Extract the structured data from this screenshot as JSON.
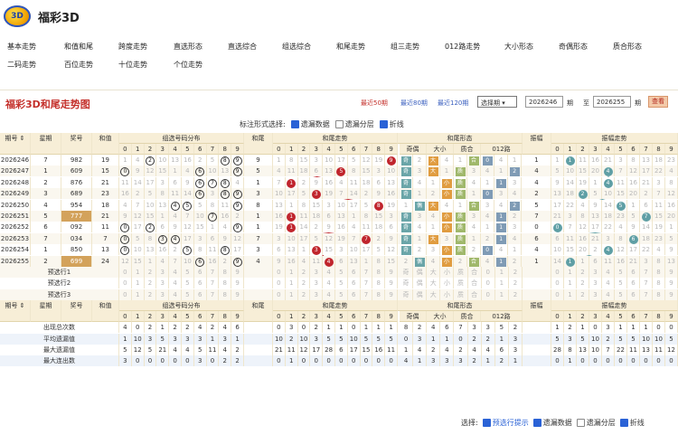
{
  "app": {
    "title": "福彩3D",
    "logo_text": "3D"
  },
  "nav": {
    "row1": [
      "基本走势",
      "和值和尾",
      "跨度走势",
      "直选形态",
      "直选综合",
      "组选综合",
      "和尾走势",
      "组三走势",
      "012路走势",
      "大小形态",
      "奇偶形态",
      "质合形态"
    ],
    "row2": [
      "二码走势",
      "百位走势",
      "十位走势",
      "个位走势"
    ]
  },
  "panel": {
    "title": "福彩3D和尾走势图",
    "recent_links": [
      "最近50期",
      "最近80期",
      "最近120期"
    ],
    "select_value": "选择期",
    "from_issue": "2026246",
    "from_suffix": "期",
    "to_label": "至",
    "to_issue": "2026255",
    "to_suffix": "期",
    "query_button": "查看",
    "opts_label": "标注形式选择:",
    "opts": [
      {
        "label": "遗漏数据",
        "checked": true
      },
      {
        "label": "遗漏分层",
        "checked": false
      },
      {
        "label": "折线",
        "checked": true
      }
    ]
  },
  "headers": {
    "issue": "期号",
    "weekday": "星期",
    "number": "奖号",
    "sum": "和值",
    "group_dist": "组选号码分布",
    "sum_tail": "和尾",
    "tail_trend": "和尾走势",
    "tail_shape": "和尾形态",
    "parity": "奇偶",
    "size": "大小",
    "prime": "质合",
    "road": "012路",
    "amplitude": "振幅",
    "amp_trend": "振幅走势",
    "digits": [
      "0",
      "1",
      "2",
      "3",
      "4",
      "5",
      "6",
      "7",
      "8",
      "9"
    ],
    "shape_sub": [
      "奇",
      "偶",
      "大",
      "小",
      "质",
      "合",
      "0",
      "1",
      "2"
    ]
  },
  "rows": [
    {
      "issue": "2026246",
      "week": "7",
      "num": "982",
      "sum": "19",
      "tail": "9",
      "amp": "1"
    },
    {
      "issue": "2026247",
      "week": "1",
      "num": "609",
      "sum": "15",
      "tail": "5",
      "amp": "4"
    },
    {
      "issue": "2026248",
      "week": "2",
      "num": "876",
      "sum": "21",
      "tail": "1",
      "amp": "4"
    },
    {
      "issue": "2026249",
      "week": "3",
      "num": "689",
      "sum": "23",
      "tail": "3",
      "amp": "2"
    },
    {
      "issue": "2026250",
      "week": "4",
      "num": "954",
      "sum": "18",
      "tail": "8",
      "amp": "5"
    },
    {
      "issue": "2026251",
      "week": "5",
      "num": "777",
      "sum": "21",
      "tail": "1",
      "amp": "7"
    },
    {
      "issue": "2026252",
      "week": "6",
      "num": "092",
      "sum": "11",
      "tail": "1",
      "amp": "0"
    },
    {
      "issue": "2026253",
      "week": "7",
      "num": "034",
      "sum": "7",
      "tail": "7",
      "amp": "6"
    },
    {
      "issue": "2026254",
      "week": "1",
      "num": "850",
      "sum": "13",
      "tail": "3",
      "amp": "4"
    },
    {
      "issue": "2026255",
      "week": "2",
      "num": "699",
      "sum": "24",
      "tail": "4",
      "amp": "1"
    }
  ],
  "prerows": [
    "预选行1",
    "预选行2",
    "预选行3"
  ],
  "stats": [
    {
      "label": "出现总次数",
      "group": [
        "4",
        "0",
        "2",
        "1",
        "2",
        "2",
        "4",
        "2",
        "4",
        "6"
      ],
      "tail": [
        "0",
        "3",
        "0",
        "2",
        "1",
        "1",
        "0",
        "1",
        "1",
        "1"
      ],
      "shape": [
        "8",
        "2",
        "4",
        "6",
        "7",
        "3",
        "3",
        "5",
        "2"
      ],
      "amp": [
        "1",
        "2",
        "1",
        "0",
        "3",
        "1",
        "1",
        "1",
        "0",
        "0"
      ]
    },
    {
      "label": "平均遗漏值",
      "group": [
        "1",
        "10",
        "3",
        "5",
        "3",
        "3",
        "3",
        "1",
        "3",
        "1"
      ],
      "tail": [
        "10",
        "2",
        "10",
        "3",
        "5",
        "5",
        "10",
        "5",
        "5",
        "5"
      ],
      "shape": [
        "0",
        "3",
        "1",
        "1",
        "0",
        "2",
        "2",
        "1",
        "3"
      ],
      "amp": [
        "5",
        "3",
        "5",
        "10",
        "2",
        "5",
        "5",
        "10",
        "10",
        "5"
      ]
    },
    {
      "label": "最大遗漏值",
      "group": [
        "5",
        "12",
        "5",
        "21",
        "4",
        "4",
        "5",
        "11",
        "4",
        "2"
      ],
      "tail": [
        "21",
        "11",
        "12",
        "17",
        "28",
        "6",
        "17",
        "15",
        "16",
        "11"
      ],
      "shape": [
        "1",
        "4",
        "2",
        "4",
        "2",
        "4",
        "4",
        "6",
        "3"
      ],
      "amp": [
        "28",
        "8",
        "13",
        "10",
        "7",
        "22",
        "11",
        "13",
        "11",
        "12"
      ]
    },
    {
      "label": "最大连出数",
      "group": [
        "3",
        "0",
        "0",
        "0",
        "0",
        "0",
        "3",
        "0",
        "2",
        "2"
      ],
      "tail": [
        "0",
        "1",
        "0",
        "0",
        "0",
        "0",
        "0",
        "0",
        "0",
        "0"
      ],
      "shape": [
        "4",
        "1",
        "3",
        "3",
        "3",
        "2",
        "1",
        "2",
        "1"
      ],
      "amp": [
        "0",
        "1",
        "0",
        "0",
        "0",
        "0",
        "0",
        "0",
        "0",
        "0"
      ]
    }
  ],
  "footer": {
    "label": "选择:",
    "opts": [
      {
        "label": "预选行提示",
        "checked": true,
        "color": "#2a62d6"
      },
      {
        "label": "遗漏数据",
        "checked": true
      },
      {
        "label": "遗漏分层",
        "checked": false
      },
      {
        "label": "折线",
        "checked": true
      }
    ]
  },
  "colors": {
    "accent": "#c4302b",
    "header_bg": "#f7eed7",
    "line_red": "#c0252d",
    "line_teal": "#5f9fa5"
  }
}
